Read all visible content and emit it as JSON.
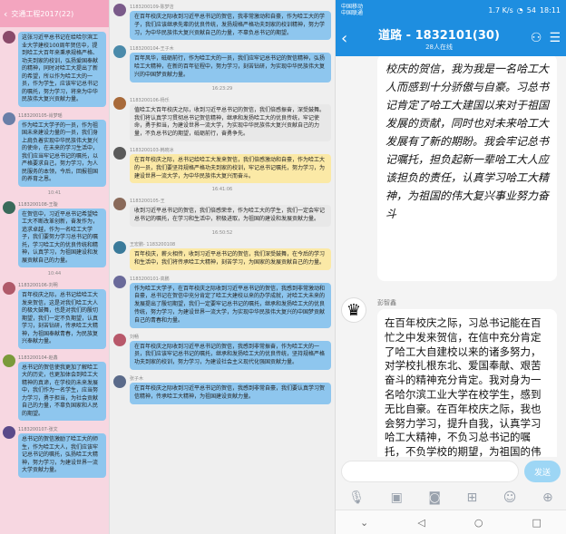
{
  "panel1": {
    "title": "交通工程2017(22)",
    "messages": [
      {
        "name": "",
        "avatar": "#8a4a6a",
        "text": "这张习近平总书记在给哈尔滨工业大学建校100周年贺信中，提到哈工大百年来秉承规格严格、功夫到家的校训，弘扬爱国奉献的精神，同时对哈工大提出了新的希望，所以作为哈工大的一员，作为学生，应该牢记总书记的嘱托，努力学习，将来为中华民族伟大复兴贡献力量。",
        "hand": false
      },
      {
        "name": "1183200105-肖梦瑶",
        "avatar": "#6a7fa8",
        "text": "作为哈工大学子的一员，作为祖国未来建设力量的一员，我们身上肩负着实现中华民族伟大复兴的使命，在未来的学习生活中，我们应当牢记总书记的嘱托，以严格要求自己，努力学习，为人民服务的本领，今后，回报祖国的养育之恩。",
        "hand": false
      },
      {
        "time": "10:41"
      },
      {
        "name": "1183200108-王璇",
        "avatar": "#3a6a5a",
        "text": "在贺信中，习近平总书记希望哈工大不断改革创新，奋发作为，追求卓越，作为一名哈工大学子，我们要努力学习总书记的嘱托，学习哈工大的优良传统和精神，认真学习，为祖国建设和发展贡献自己的力量。",
        "hand": false
      },
      {
        "time": "10:44"
      },
      {
        "name": "1183200106-刘明",
        "avatar": "#b05a6a",
        "text": "百年校庆之际，总书记给哈工大发来贺信，这是对我们哈工大人的极大鼓舞，也是对我们的殷切期望，我们一定不负期望，认真学习，刻苦钻研，传承哈工大精神，为祖国奉献青春，为民族复兴奉献力量。",
        "hand": true
      },
      {
        "name": "1183200104-赵鑫",
        "avatar": "#7a9a3a",
        "text": "总书记的贺信使我更加了解哈工大的历史，也更加体会到哈工大精神的真谛，在学校的未来发展中，我们作为一名学生，应当努力学习，勇于担当，为社会贡献自己的力量，不辜负国家和人民的期望。",
        "hand": false
      },
      {
        "name": "1183200107-张文",
        "avatar": "#5a4a8a",
        "text": "总书记的贺信激励了哈工大的师生，作为哈工大人，我们应该牢记总书记的嘱托，弘扬哈工大精神，努力学习，为建设世界一流大学贡献力量。",
        "hand": false
      }
    ]
  },
  "panel2": {
    "messages": [
      {
        "name": "1183200109-陈梦洁",
        "avatar": "#7a5a8a",
        "bg": "#8ec6ee",
        "text": "在百年校庆之际收到习近平总书记的贺信，我非常激动和自豪，作为哈工大的学子，我们应该继承先辈的优良传统，发扬规格严格功夫到家的校训精神，努力学习，为中华民族伟大复兴贡献自己的力量，不辜负总书记的期望。"
      },
      {
        "name": "1183200104-王子木",
        "avatar": "#4a8aaa",
        "bg": "#8ec6ee",
        "text": "百年风华，砥砺前行，作为哈工大的一员，我们应牢记总书记的贺信精神，弘扬哈工大精神，在新的百年征程中，努力学习，刻苦钻研，为实现中华民族伟大复兴的中国梦贡献力量。"
      },
      {
        "time": "16:23:29"
      },
      {
        "name": "1183200106-杨乐",
        "avatar": "#a86a3a",
        "bg": "#e8e8e8",
        "text": "值哈工大百年校庆之际，收到习近平总书记的贺信，我们倍感振奋，深受鼓舞。我们将认真学习贯彻总书记贺信精神，继承和发扬哈工大的优良传统，牢记使命，勇于担当，为建设世界一流大学，为实现中华民族伟大复兴贡献自己的力量，不负总书记的期望，砥砺前行，奋勇争先。"
      },
      {
        "name": "1183200103-韩晓冰",
        "avatar": "#5a5a5a",
        "bg": "#fbe9a6",
        "text": "在百年校庆之际，总书记给哈工大发来贺信，我们倍感激动和自豪，作为哈工大的一员，我们要坚持规格严格功夫到家的校训，牢记总书记嘱托，努力学习，为建设世界一流大学，为中华民族伟大复兴而奋斗。"
      },
      {
        "time": "16:41:06"
      },
      {
        "name": "1183200105-王",
        "avatar": "#8a6a5a",
        "bg": "#e8e8e8",
        "text": "收到习近平总书记的贺信，我们倍感荣幸，作为哈工大的学生，我们一定会牢记总书记的嘱托，在学习和生活中，积极进取，为祖国的建设和发展贡献力量。"
      },
      {
        "time": "16:50:52"
      },
      {
        "name": "王宏鹏- 1183200108",
        "avatar": "#3a7a9a",
        "bg": "#fbe9a6",
        "text": "百年校庆，薪火相传，收到习近平总书记的贺信，我们深受鼓舞，在今后的学习和生活中，我们将传承哈工大精神，刻苦学习，为国家的发展贡献自己的力量。"
      },
      {
        "name": "1183200101-高鹏",
        "avatar": "#6a6a9a",
        "bg": "#8ec6ee",
        "text": "作为哈工大学子，在百年校庆之际收到习近平总书记的贺信，我感到非常激动和自豪，总书记在贺信中充分肯定了哈工大建校以来的办学成就，对哈工大未来的发展提出了殷切期望，我们一定要牢记总书记的嘱托，继承和发扬哈工大的优良传统，努力学习，为建设世界一流大学，为实现中华民族伟大复兴的中国梦贡献自己的青春和力量。"
      },
      {
        "name": "刘畅",
        "avatar": "#b8586a",
        "bg": "#8ec6ee",
        "text": "在百年校庆之际收到习近平总书记的贺信，我感到非常振奋，作为哈工大的一员，我们应该牢记总书记的嘱托，继承和发扬哈工大的优良传统，坚持规格严格功夫到家的校训，努力学习，为建设社会主义现代化强国贡献力量。"
      },
      {
        "name": "张子木",
        "avatar": "#5a6a8a",
        "bg": "#8ec6ee",
        "text": "在百年校庆之际收到习近平总书记的贺信，我感到非常自豪，我们要认真学习贺信精神，传承哈工大精神，为祖国建设贡献力量。"
      }
    ]
  },
  "panel3": {
    "status": {
      "carrier1": "中国移动",
      "carrier2": "中国联通",
      "speed": "1.7 K/s",
      "battery": "54",
      "time": "18:11"
    },
    "nav": {
      "title": "道路 - 1832101(30)",
      "subtitle": "28人在线"
    },
    "handwritten": "校庆的贺信，我为我是一名哈工大人而感到十分骄傲与自豪。习总书记肯定了哈工大建国以来对于祖国发展的贡献，同时也对未来哈工大发展有了新的期盼。我会牢记总书记嘱托，担负起新一辈哈工大人应该担负的责任，认真学习哈工大精神，为祖国的伟大复兴事业努力奋斗",
    "sender": "彭智鑫",
    "message": "在百年校庆之际，习总书记能在百忙之中发来贺信，在信中充分肯定了哈工大自建校以来的诸多努力，对学校扎根东北、爱国奉献、艰苦奋斗的精神充分肯定。我对身为一名哈尔滨工业大学在校学生，感到无比自豪。在百年校庆之际，我也会努力学习，提升自我，认真学习哈工大精神，不负习总书记的嘱托，不负学校的期望，为祖国的伟大复兴贡献自己的力量。",
    "send_label": "发送"
  }
}
